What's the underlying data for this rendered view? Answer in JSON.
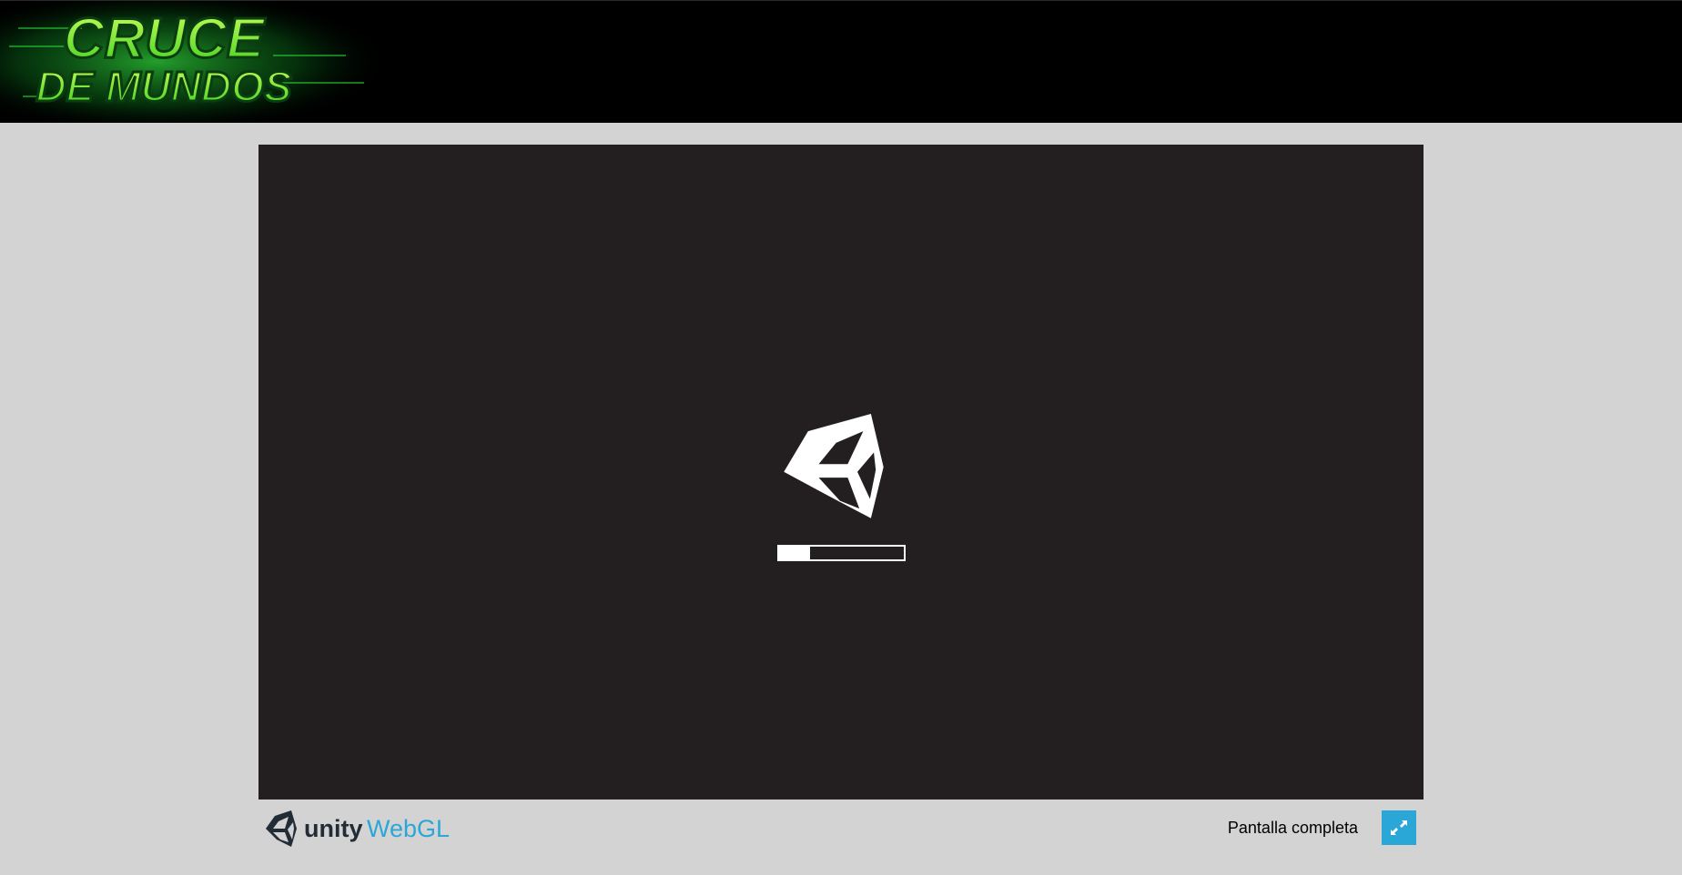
{
  "header": {
    "logo_text_line1": "CRUCE",
    "logo_text_line2": "DE MUNDOS"
  },
  "player": {
    "loading_icon": "unity-logo-icon",
    "progress_fraction": 0.25
  },
  "footer": {
    "brand_unity": "unity",
    "brand_webgl": "WebGL",
    "fullscreen_label": "Pantalla completa",
    "fullscreen_icon": "expand-arrows-icon"
  },
  "colors": {
    "header_bg": "#000000",
    "page_bg": "#d3d3d3",
    "canvas_bg": "#231f20",
    "accent_blue": "#2aa7d6",
    "logo_green": "#7de23a"
  }
}
